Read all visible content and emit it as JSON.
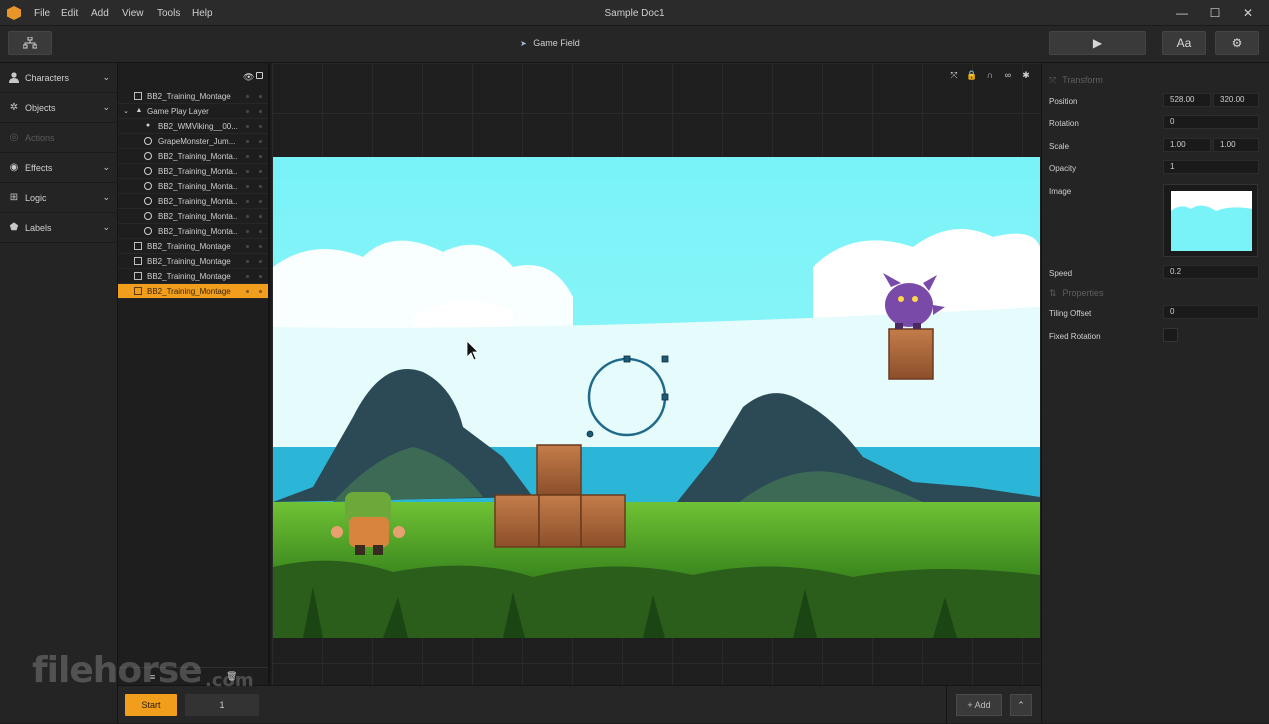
{
  "window": {
    "title": "Sample Doc1",
    "menu": [
      "File",
      "Edit",
      "Add",
      "View",
      "Tools",
      "Help"
    ],
    "controls": {
      "minimize": "—",
      "maximize": "☐",
      "close": "✕"
    }
  },
  "toolbar": {
    "scene_label": "Game Field",
    "play_label": "▶",
    "text_label": "Aa",
    "settings_label": "⚙"
  },
  "left_panel": {
    "categories": [
      {
        "label": "Characters",
        "icon": "person-icon",
        "enabled": true
      },
      {
        "label": "Objects",
        "icon": "gear-icon",
        "enabled": true
      },
      {
        "label": "Actions",
        "icon": "actions-icon",
        "enabled": false
      },
      {
        "label": "Effects",
        "icon": "effects-icon",
        "enabled": true
      },
      {
        "label": "Logic",
        "icon": "logic-icon",
        "enabled": true
      },
      {
        "label": "Labels",
        "icon": "tag-icon",
        "enabled": true
      }
    ]
  },
  "layers": {
    "rows": [
      {
        "text": "BB2_Training_Montage...",
        "type": "image",
        "indent": 0,
        "selected": false
      },
      {
        "text": "Game Play Layer",
        "type": "layer",
        "indent": 0,
        "selected": false
      },
      {
        "text": "BB2_WMViking__00...",
        "type": "character",
        "indent": 1,
        "selected": false
      },
      {
        "text": "GrapeMonster_Jum...",
        "type": "object",
        "indent": 1,
        "selected": false
      },
      {
        "text": "BB2_Training_Monta...",
        "type": "object",
        "indent": 1,
        "selected": false
      },
      {
        "text": "BB2_Training_Monta...",
        "type": "object",
        "indent": 1,
        "selected": false
      },
      {
        "text": "BB2_Training_Monta...",
        "type": "object",
        "indent": 1,
        "selected": false
      },
      {
        "text": "BB2_Training_Monta...",
        "type": "object",
        "indent": 1,
        "selected": false
      },
      {
        "text": "BB2_Training_Monta...",
        "type": "object",
        "indent": 1,
        "selected": false
      },
      {
        "text": "BB2_Training_Monta...",
        "type": "object",
        "indent": 1,
        "selected": false
      },
      {
        "text": "BB2_Training_Montage...",
        "type": "image",
        "indent": 0,
        "selected": false
      },
      {
        "text": "BB2_Training_Montage...",
        "type": "image",
        "indent": 0,
        "selected": false
      },
      {
        "text": "BB2_Training_Montage...",
        "type": "image",
        "indent": 0,
        "selected": false
      },
      {
        "text": "BB2_Training_Montage...",
        "type": "image",
        "indent": 0,
        "selected": true
      }
    ]
  },
  "properties": {
    "transform_title": "Transform",
    "position_label": "Position",
    "position_x": "528.00",
    "position_y": "320.00",
    "rotation_label": "Rotation",
    "rotation": "0",
    "scale_label": "Scale",
    "scale_x": "1.00",
    "scale_y": "1.00",
    "opacity_label": "Opacity",
    "opacity": "1",
    "image_label": "Image",
    "speed_label": "Speed",
    "speed": "0.2",
    "properties_title": "Properties",
    "tiling_label": "Tiling Offset",
    "tiling": "0",
    "fixed_rotation_label": "Fixed Rotation"
  },
  "bottom": {
    "start_label": "Start",
    "frame_value": "1",
    "add_label": "+ Add",
    "up_label": "⌃"
  },
  "watermark": {
    "main": "filehorse",
    "sub": ".com"
  },
  "colors": {
    "accent": "#f29e1d",
    "sky": "#7cf2f7",
    "grass": "#3c8a1e",
    "sea": "#2bb6d8"
  }
}
